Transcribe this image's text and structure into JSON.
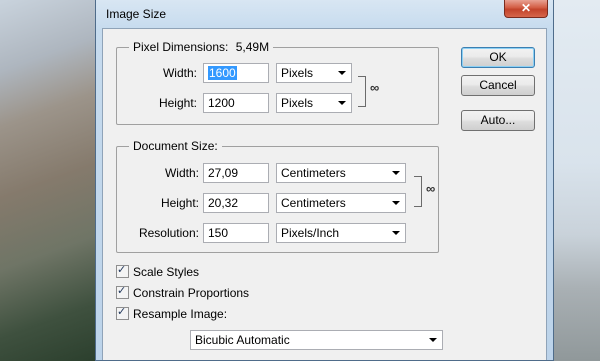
{
  "window": {
    "title": "Image Size",
    "close_glyph": "✕"
  },
  "pixel_dimensions": {
    "legend": "Pixel Dimensions:",
    "size_value": "5,49M",
    "width_label": "Width:",
    "width_value": "1600",
    "width_unit": "Pixels",
    "height_label": "Height:",
    "height_value": "1200",
    "height_unit": "Pixels"
  },
  "document_size": {
    "legend": "Document Size:",
    "width_label": "Width:",
    "width_value": "27,09",
    "width_unit": "Centimeters",
    "height_label": "Height:",
    "height_value": "20,32",
    "height_unit": "Centimeters",
    "resolution_label": "Resolution:",
    "resolution_value": "150",
    "resolution_unit": "Pixels/Inch"
  },
  "buttons": {
    "ok": "OK",
    "cancel": "Cancel",
    "auto": "Auto..."
  },
  "options": {
    "scale_styles": {
      "label": "Scale Styles",
      "checked": true
    },
    "constrain_proportions": {
      "label": "Constrain Proportions",
      "checked": true
    },
    "resample_image": {
      "label": "Resample Image:",
      "checked": true
    },
    "resample_method": "Bicubic Automatic"
  },
  "icons": {
    "chain_link": "chain-link-icon",
    "check": "checkmark-icon",
    "dropdown": "chevron-down-icon"
  }
}
